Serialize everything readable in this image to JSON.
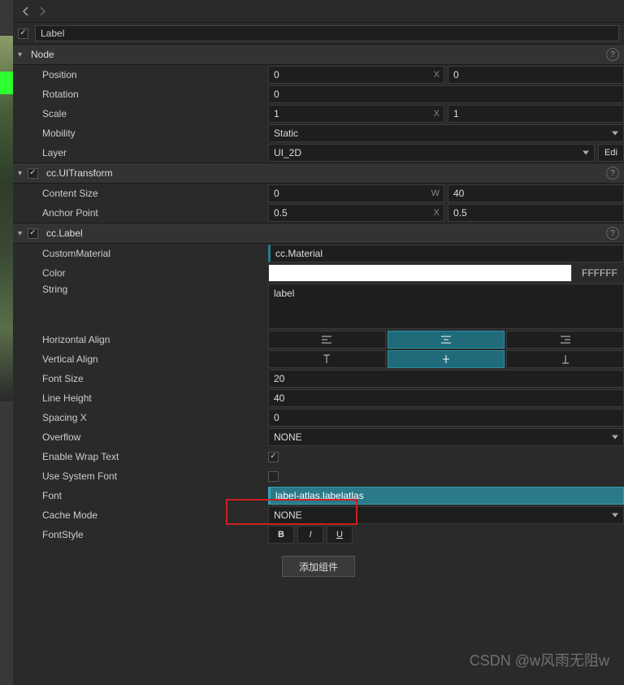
{
  "header": {
    "name_value": "Label"
  },
  "node": {
    "title": "Node",
    "position": {
      "label": "Position",
      "x": "0",
      "y": "0"
    },
    "rotation": {
      "label": "Rotation",
      "value": "0"
    },
    "scale": {
      "label": "Scale",
      "x": "1",
      "y": "1"
    },
    "mobility": {
      "label": "Mobility",
      "value": "Static"
    },
    "layer": {
      "label": "Layer",
      "value": "UI_2D",
      "edit": "Edi"
    }
  },
  "uitransform": {
    "title": "cc.UITransform",
    "contentSize": {
      "label": "Content Size",
      "w": "0",
      "h": "40"
    },
    "anchor": {
      "label": "Anchor Point",
      "x": "0.5",
      "y": "0.5"
    }
  },
  "label": {
    "title": "cc.Label",
    "customMaterial": {
      "label": "CustomMaterial",
      "value": "cc.Material"
    },
    "color": {
      "label": "Color",
      "hex": "FFFFFF"
    },
    "string": {
      "label": "String",
      "value": "label"
    },
    "halign": {
      "label": "Horizontal Align"
    },
    "valign": {
      "label": "Vertical Align"
    },
    "fontSize": {
      "label": "Font Size",
      "value": "20"
    },
    "lineHeight": {
      "label": "Line Height",
      "value": "40"
    },
    "spacingX": {
      "label": "Spacing X",
      "value": "0"
    },
    "overflow": {
      "label": "Overflow",
      "value": "NONE"
    },
    "enableWrap": {
      "label": "Enable Wrap Text"
    },
    "useSystemFont": {
      "label": "Use System Font"
    },
    "font": {
      "label": "Font",
      "value": "label-atlas.labelatlas"
    },
    "cacheMode": {
      "label": "Cache Mode",
      "value": "NONE"
    },
    "fontStyle": {
      "label": "FontStyle",
      "b": "B",
      "i": "I",
      "u": "U"
    }
  },
  "addComponent": "添加组件",
  "watermark": "CSDN @w风雨无阻w"
}
